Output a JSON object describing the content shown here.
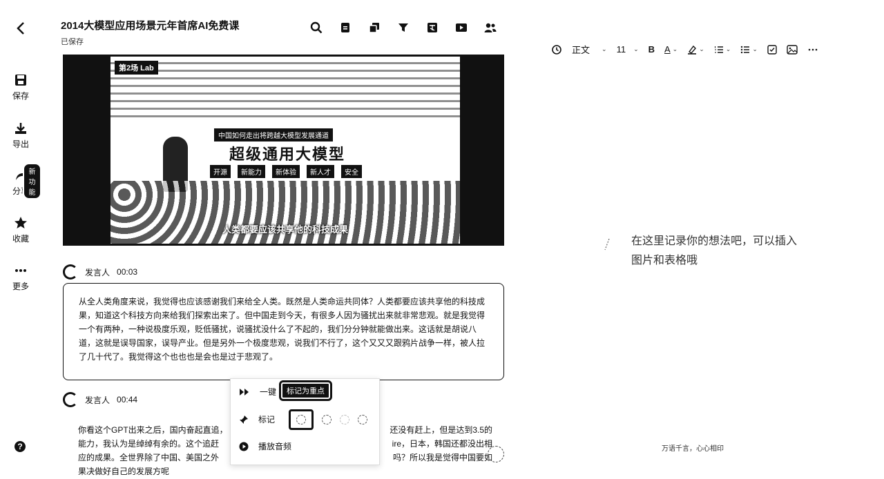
{
  "header": {
    "title": "2014大模型应用场景元年首席AI免费课",
    "saved_status": "已保存"
  },
  "rail": {
    "save": "保存",
    "export": "导出",
    "share": "分享",
    "share_badge": "新功能",
    "favorite": "收藏",
    "more": "更多"
  },
  "video": {
    "logo_text": "第2场 Lab",
    "banner_sub": "中国如何走出将跨越大模型发展通道",
    "banner_main": "超级通用大模型",
    "tags": [
      "开源",
      "新能力",
      "新体验",
      "新人才",
      "安全"
    ],
    "subtitle": "人类都要应该共享他的科技成果"
  },
  "transcript": [
    {
      "speaker": "发言人",
      "time": "00:03",
      "text": "从全人类角度来说，我觉得也应该感谢我们来给全人类。既然是人类命运共同体？人类都要应该共享他的科技成果，知道这个科技方向来给我们探索出来了。但中国走到今天，有很多人因为骚扰出来就非常悲观。就是我觉得一个有两种，一种说极度乐观，贬低骚扰，说骚扰没什么了不起的，我们分分钟就能做出来。这话就是胡说八道，这就是误导国家，误导产业。但是另外一个极度悲观，说我们不行了，这个又又又跟鸦片战争一样，被人拉了几十代了。我觉得这个也也也是会也是过于悲观了。"
    },
    {
      "speaker": "发言人",
      "time": "00:44",
      "text_start": "你看这个GPT出来之后，国内奋起直追，",
      "text_right1": "还没有赶上，但是达到3.5的",
      "line2_start": "能力，我认为是绰绰有余的。这个追赶",
      "line2_right": "ire，日本，韩国还都没出相",
      "line3_start": "应的成果。全世界除了中国、美国之外",
      "line3_right": "吗？所以我是觉得中国要如",
      "line4_start": "果决做好自己的发展方呢"
    }
  ],
  "popup": {
    "one_click": "一键",
    "tooltip": "标记为重点",
    "mark": "标记",
    "play_audio": "播放音频"
  },
  "editor": {
    "style": "正文",
    "font_size": "11",
    "placeholder": "在这里记录你的想法吧，可以插入图片和表格哦",
    "footer_hint": "万语千言，心心相印"
  }
}
